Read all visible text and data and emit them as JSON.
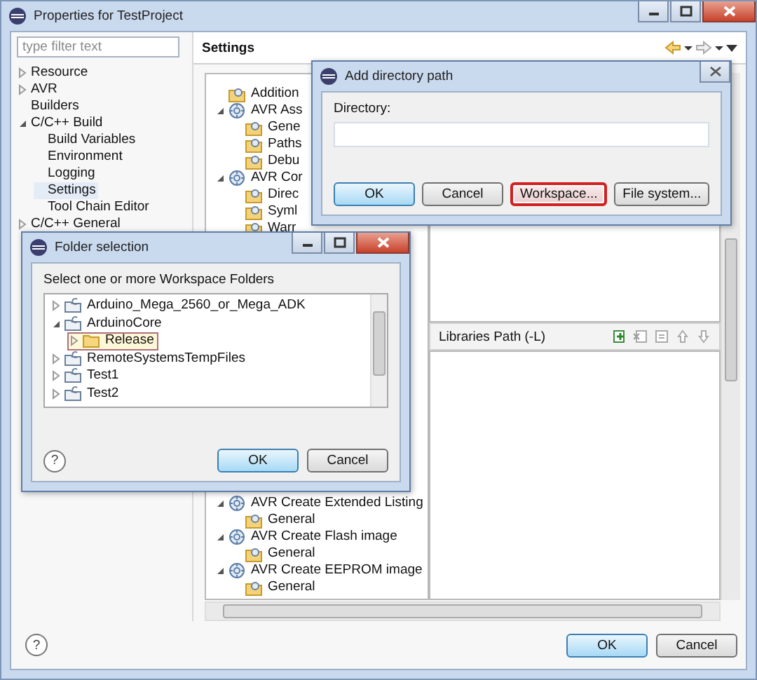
{
  "window": {
    "title": "Properties for TestProject"
  },
  "filter": {
    "placeholder": "type filter text"
  },
  "sidebar": {
    "items": [
      {
        "label": "Resource",
        "expanded": false,
        "selected": false
      },
      {
        "label": "AVR",
        "expanded": false,
        "selected": false
      },
      {
        "label": "Builders",
        "selected": false
      },
      {
        "label": "C/C++ Build",
        "expanded": true,
        "selected": false,
        "children": [
          {
            "label": "Build Variables",
            "selected": false
          },
          {
            "label": "Environment",
            "selected": false
          },
          {
            "label": "Logging",
            "selected": false
          },
          {
            "label": "Settings",
            "selected": true
          },
          {
            "label": "Tool Chain Editor",
            "selected": false
          }
        ]
      },
      {
        "label": "C/C++ General",
        "expanded": false,
        "selected": false
      }
    ]
  },
  "page": {
    "title": "Settings",
    "tool_tree_top": [
      {
        "label": "Addition",
        "kind": "options"
      },
      {
        "label": "AVR Ass",
        "kind": "tool",
        "expanded": true,
        "children": [
          {
            "label": "Gene",
            "kind": "options"
          },
          {
            "label": "Paths",
            "kind": "options"
          },
          {
            "label": "Debu",
            "kind": "options"
          }
        ]
      },
      {
        "label": "AVR Cor",
        "kind": "tool",
        "expanded": true,
        "children": [
          {
            "label": "Direc",
            "kind": "options"
          },
          {
            "label": "Syml",
            "kind": "options"
          },
          {
            "label": "Warr",
            "kind": "options"
          }
        ]
      }
    ],
    "tool_tree_bottom": [
      {
        "label": "AVR Create Extended Listing",
        "kind": "tool",
        "expanded": true,
        "children": [
          {
            "label": "General",
            "kind": "options"
          }
        ]
      },
      {
        "label": "AVR Create Flash image",
        "kind": "tool",
        "expanded": true,
        "children": [
          {
            "label": "General",
            "kind": "options"
          }
        ]
      },
      {
        "label": "AVR Create EEPROM image",
        "kind": "tool",
        "expanded": true,
        "children": [
          {
            "label": "General",
            "kind": "options"
          }
        ]
      }
    ],
    "libraries_header": "Libraries Path (-L)"
  },
  "footer": {
    "help": "?",
    "buttons": [
      {
        "label": "OK",
        "default": true
      },
      {
        "label": "Cancel",
        "default": false
      }
    ]
  },
  "add_directory_dialog": {
    "title": "Add directory path",
    "field_label": "Directory:",
    "buttons": [
      {
        "label": "OK",
        "default": true,
        "highlighted": false
      },
      {
        "label": "Cancel",
        "default": false,
        "highlighted": false
      },
      {
        "label": "Workspace...",
        "default": false,
        "highlighted": true
      },
      {
        "label": "File system...",
        "default": false,
        "highlighted": false
      }
    ]
  },
  "folder_dialog": {
    "title": "Folder selection",
    "prompt": "Select one or more Workspace Folders",
    "items": [
      {
        "label": "Arduino_Mega_2560_or_Mega_ADK",
        "kind": "project",
        "expanded": false,
        "selected": false
      },
      {
        "label": "ArduinoCore",
        "kind": "project",
        "expanded": true,
        "selected": false,
        "children": [
          {
            "label": "Release",
            "kind": "folder",
            "expanded": false,
            "selected": true
          }
        ]
      },
      {
        "label": "RemoteSystemsTempFiles",
        "kind": "project",
        "expanded": false,
        "selected": false
      },
      {
        "label": "Test1",
        "kind": "project",
        "expanded": false,
        "selected": false
      },
      {
        "label": "Test2",
        "kind": "project",
        "expanded": false,
        "selected": false
      }
    ],
    "help": "?",
    "buttons": [
      {
        "label": "OK",
        "default": true
      },
      {
        "label": "Cancel",
        "default": false
      }
    ]
  }
}
